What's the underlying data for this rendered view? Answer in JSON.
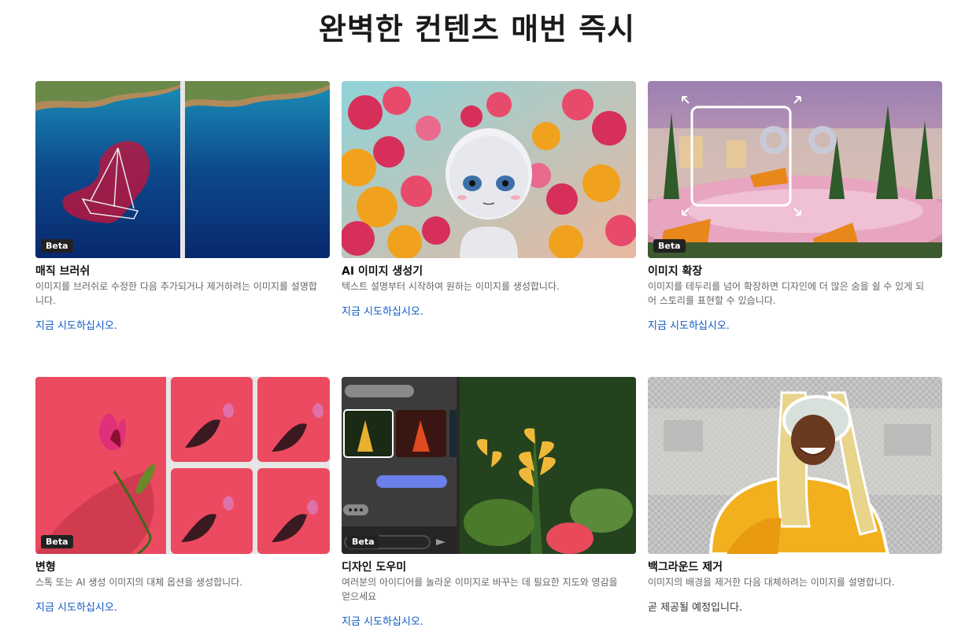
{
  "page": {
    "title": "완벽한 컨텐츠 매번 즉시"
  },
  "badge_label": "Beta",
  "cards": [
    {
      "title": "매직 브러쉬",
      "description": "이미지를 브러쉬로 수정한 다음 추가되거나 제거하려는 이미지를 설명합니다.",
      "action": "지금 시도하십시오.",
      "beta": true
    },
    {
      "title": "AI 이미지 생성기",
      "description": "텍스트 설명부터 시작하여 원하는 이미지를 생성합니다.",
      "action": "지금 시도하십시오.",
      "beta": false
    },
    {
      "title": "이미지 확장",
      "description": "이미지를 테두리를 넘어 확장하면 디자인에 더 많은 숨을 쉴 수 있게 되어 스토리를 표현할 수 있습니다.",
      "action": "지금 시도하십시오.",
      "beta": true
    },
    {
      "title": "변형",
      "description": "스톡 또는 AI 생성 이미지의 대체 옵션을 생성합니다.",
      "action": "지금 시도하십시오.",
      "beta": true
    },
    {
      "title": "디자인 도우미",
      "description": "여러분의 아이디어를 놀라운 이미지로 바꾸는 데 필요한 지도와 영감을 얻으세요",
      "action": "지금 시도하십시오.",
      "beta": true
    },
    {
      "title": "백그라운드 제거",
      "description": "이미지의 배경을 제거한 다음 대체하려는 이미지를 설명합니다.",
      "note": "곧 제공될 예정입니다.",
      "beta": false
    }
  ],
  "colors": {
    "link": "#0b57c5",
    "badge_bg": "#222222"
  }
}
